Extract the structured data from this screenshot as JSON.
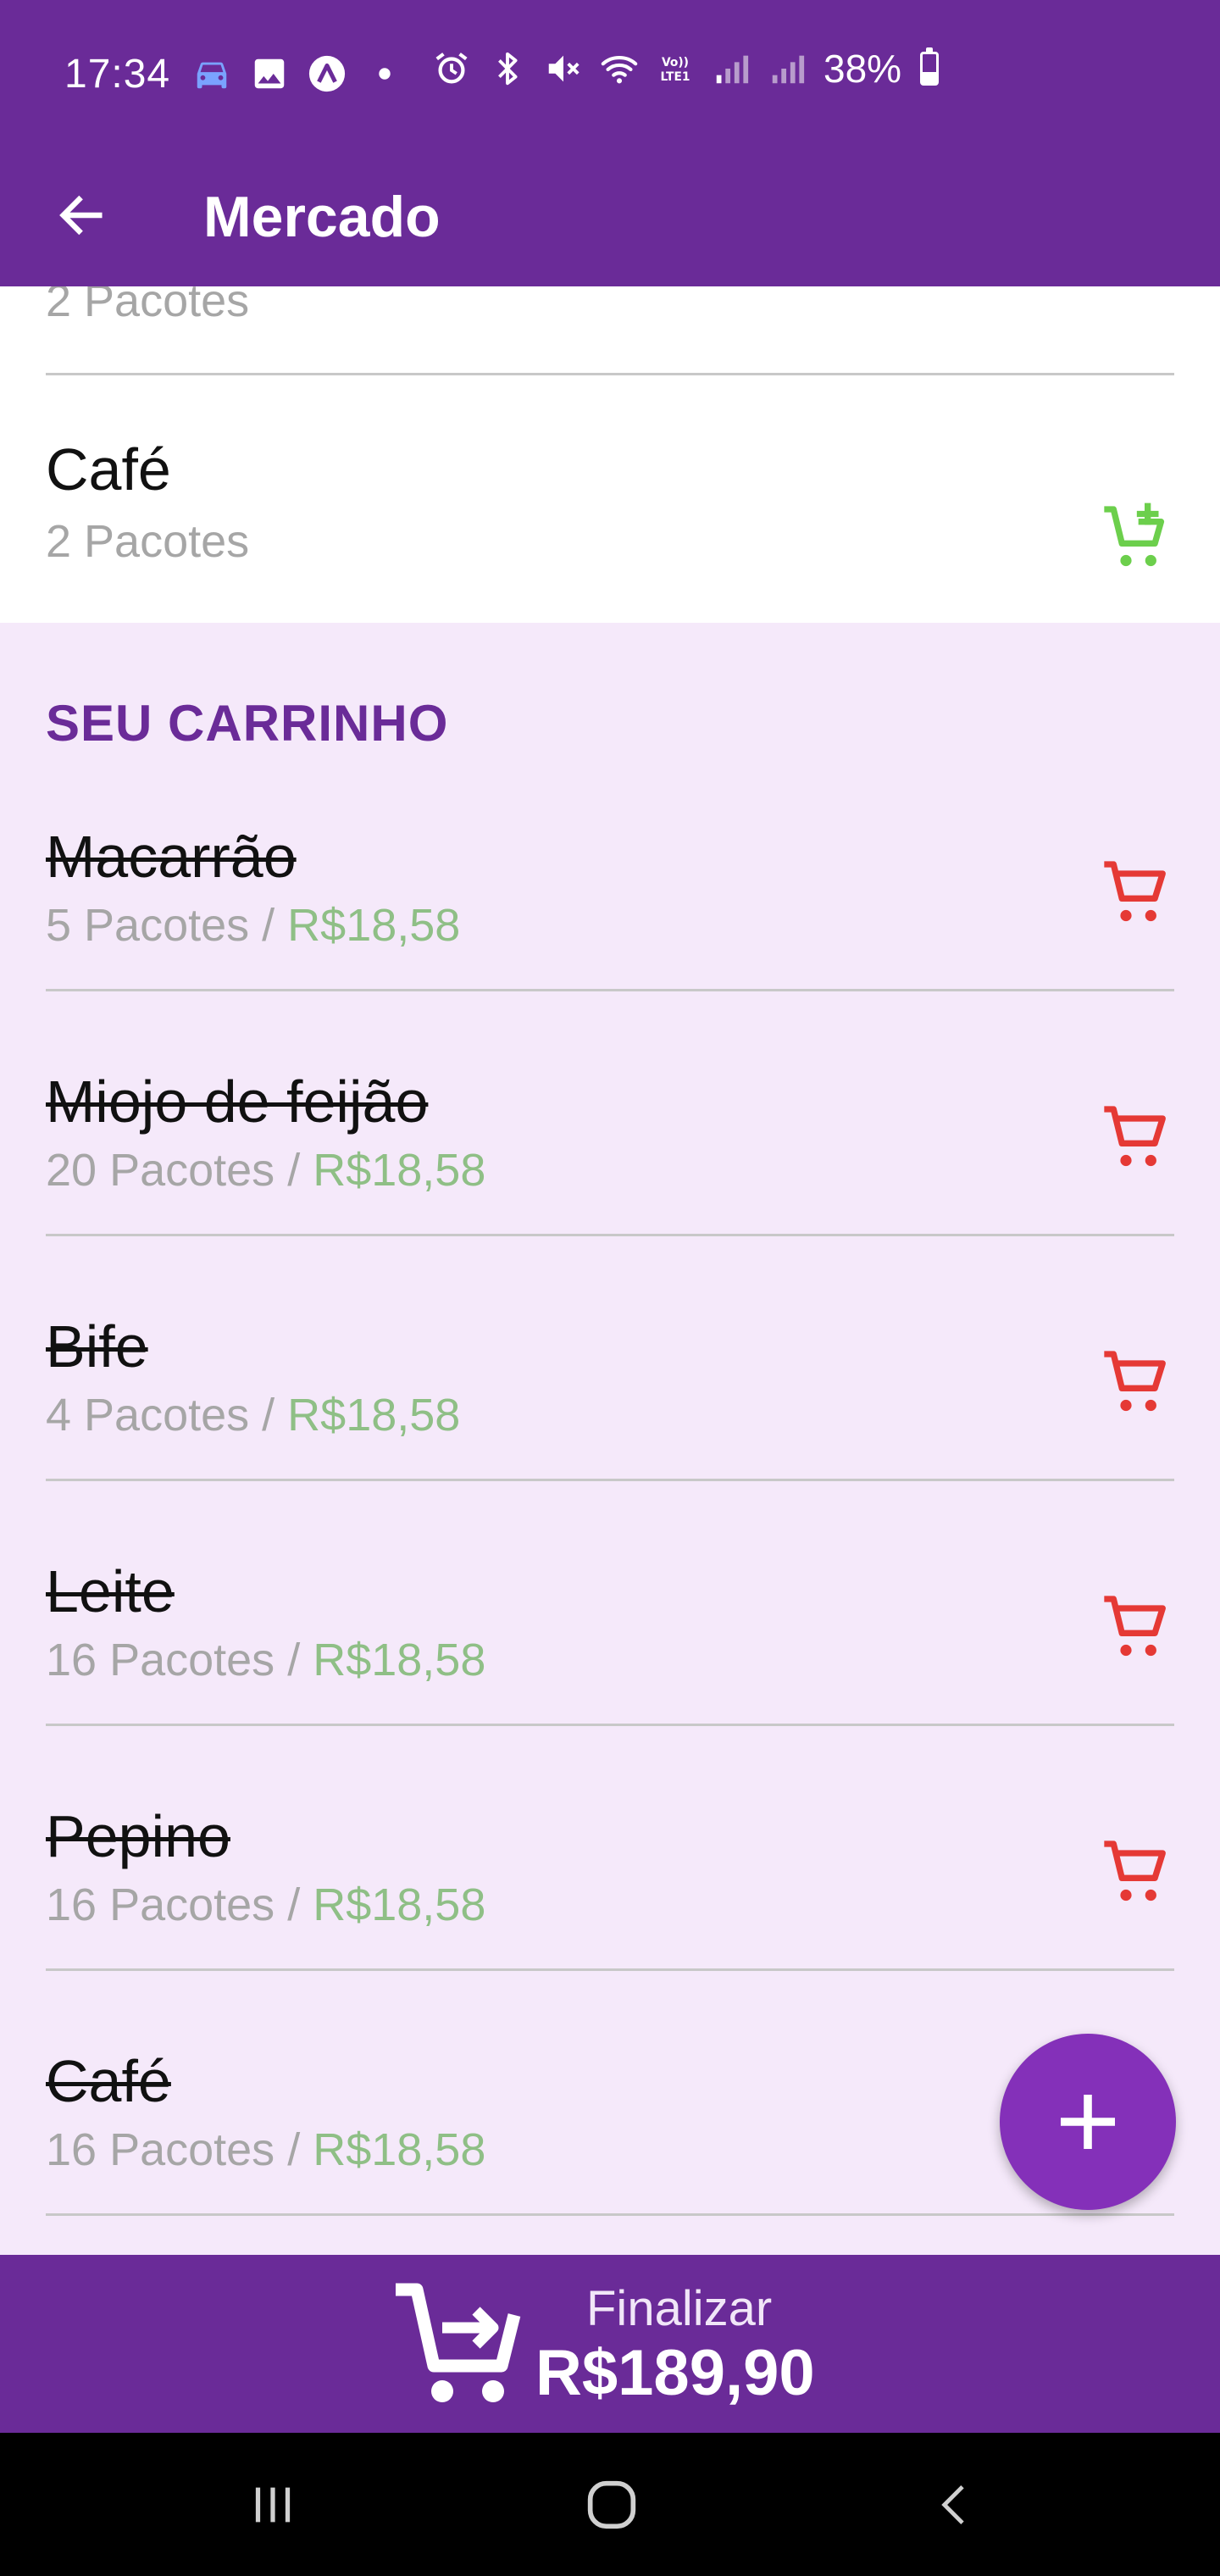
{
  "status_bar": {
    "time": "17:34",
    "battery_text": "38%",
    "battery_level": 0.38,
    "left_icons": [
      "car-icon",
      "image-icon",
      "a-icon",
      "dot-icon"
    ],
    "right_icons": [
      "alarm-icon",
      "bluetooth-icon",
      "mute-icon",
      "wifi-icon",
      "volte-icon",
      "signal-icon",
      "signal-icon"
    ],
    "volte_label": "Vo)) LTE1"
  },
  "app_bar": {
    "title": "Mercado",
    "back_icon": "arrow-left-icon"
  },
  "pending_items": [
    {
      "name": "",
      "quantity": "2 Pacotes"
    },
    {
      "name": "Café",
      "quantity": "2 Pacotes",
      "icon": "add-to-cart-icon"
    }
  ],
  "cart": {
    "title": "SEU CARRINHO",
    "separator": " / ",
    "items": [
      {
        "name": "Macarrão",
        "quantity": "5 Pacotes",
        "price": "R$18,58"
      },
      {
        "name": "Miojo de feijão",
        "quantity": "20 Pacotes",
        "price": "R$18,58"
      },
      {
        "name": "Bife",
        "quantity": "4 Pacotes",
        "price": "R$18,58"
      },
      {
        "name": "Leite",
        "quantity": "16 Pacotes",
        "price": "R$18,58"
      },
      {
        "name": "Pepino",
        "quantity": "16 Pacotes",
        "price": "R$18,58"
      },
      {
        "name": "Café",
        "quantity": "16 Pacotes",
        "price": "R$18,58"
      }
    ],
    "item_icon": "remove-from-cart-icon"
  },
  "fab": {
    "icon": "plus-icon"
  },
  "finalize": {
    "label": "Finalizar",
    "total": "R$189,90",
    "icon": "cart-checkout-icon"
  },
  "nav": {
    "recents_icon": "recents-icon",
    "home_icon": "home-icon",
    "back_icon": "back-chevron-icon"
  },
  "colors": {
    "primary": "#6a2b98",
    "fab": "#8430b9",
    "cart_background": "#f5e9fa",
    "add_icon": "#6ccf4c",
    "remove_icon": "#e53935",
    "price": "#8fbf86"
  }
}
